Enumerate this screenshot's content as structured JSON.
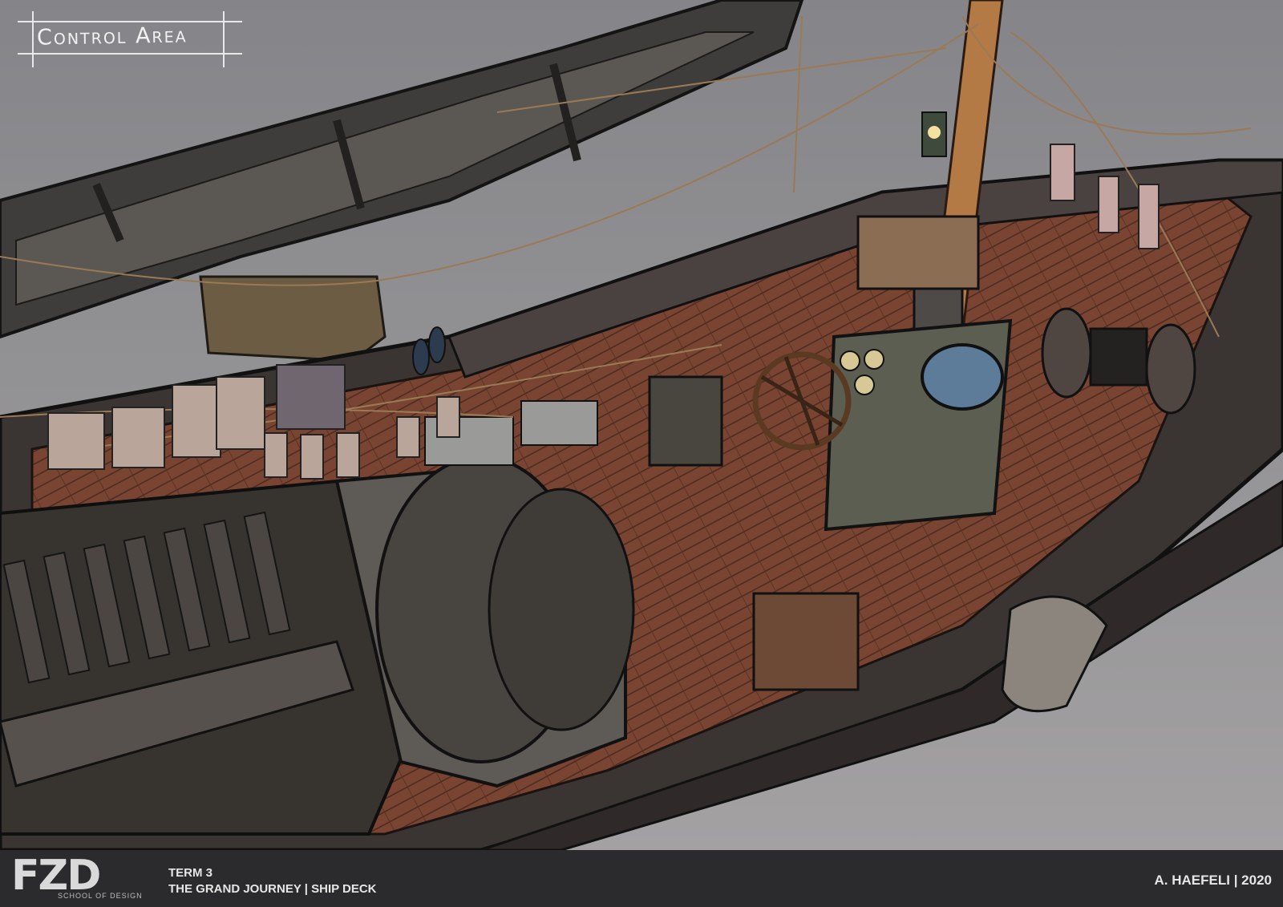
{
  "scene": {
    "subject": "airship-deck-illustration",
    "title_label": "Control Area"
  },
  "footer": {
    "logo_text": "FZD",
    "logo_sub": "SCHOOL OF DESIGN",
    "term": "TERM 3",
    "project": "THE GRAND JOURNEY | SHIP DECK",
    "credit": "A. HAEFELI | 2020"
  }
}
